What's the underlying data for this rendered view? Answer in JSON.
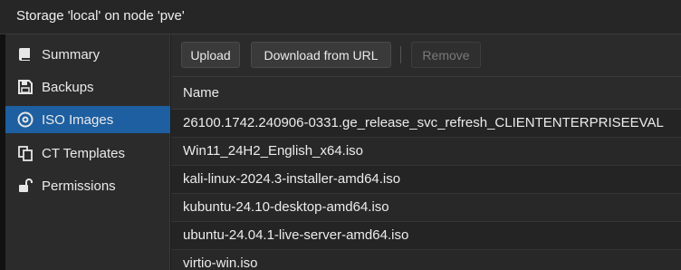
{
  "window": {
    "title": "Storage 'local' on node 'pve'"
  },
  "sidebar": {
    "items": [
      {
        "label": "Summary",
        "icon": "book-icon"
      },
      {
        "label": "Backups",
        "icon": "floppy-icon"
      },
      {
        "label": "ISO Images",
        "icon": "disc-icon",
        "active": true
      },
      {
        "label": "CT Templates",
        "icon": "copy-icon"
      },
      {
        "label": "Permissions",
        "icon": "unlock-icon"
      }
    ]
  },
  "toolbar": {
    "upload_label": "Upload",
    "download_label": "Download from URL",
    "remove_label": "Remove"
  },
  "grid": {
    "column_name": "Name",
    "rows": [
      "26100.1742.240906-0331.ge_release_svc_refresh_CLIENTENTERPRISEEVAL",
      "Win11_24H2_English_x64.iso",
      "kali-linux-2024.3-installer-amd64.iso",
      "kubuntu-24.10-desktop-amd64.iso",
      "ubuntu-24.04.1-live-server-amd64.iso",
      "virtio-win.iso"
    ]
  },
  "colors": {
    "accent": "#1d5fa0",
    "background": "#1e1e1e"
  }
}
